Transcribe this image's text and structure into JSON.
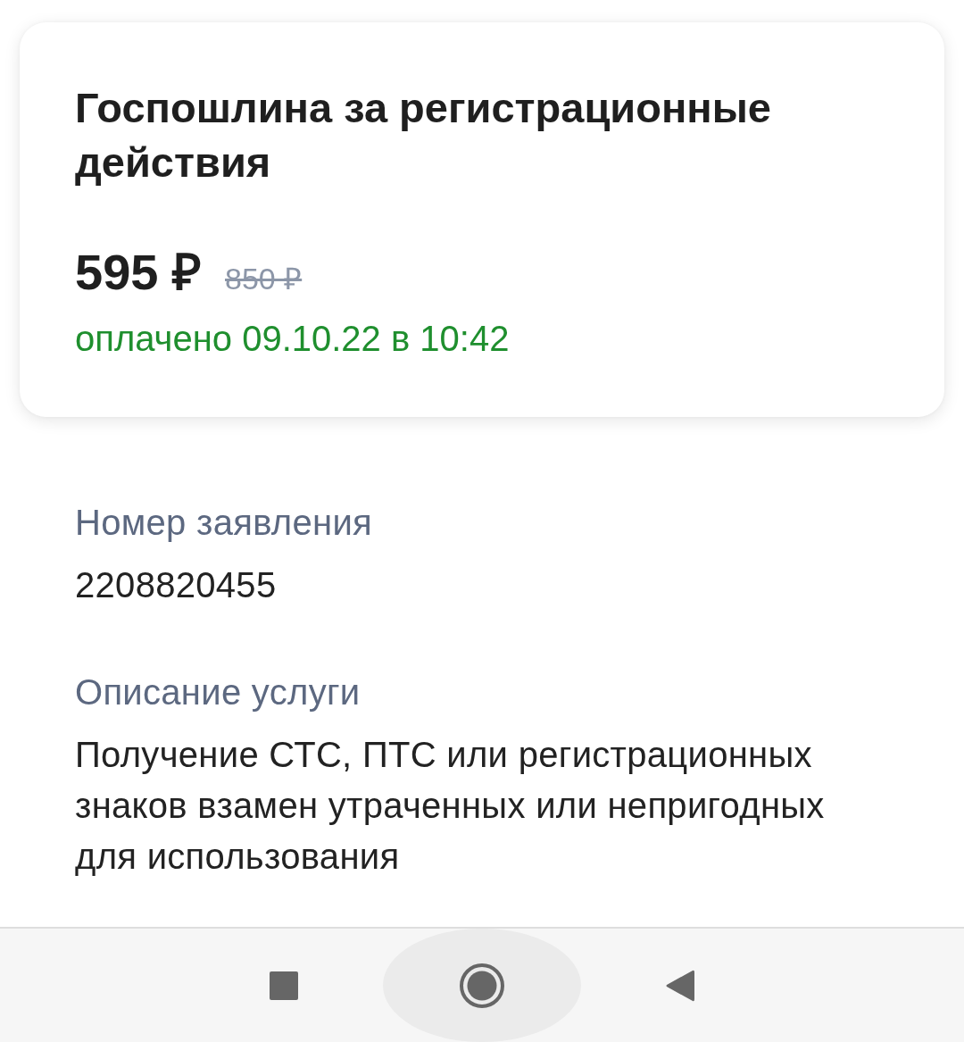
{
  "card": {
    "title": "Госпошлина за регистрационные действия",
    "price": "595 ₽",
    "old_price": "850 ₽",
    "payment_status": {
      "kind": "paid",
      "text": "оплачено 09.10.22 в 10:42"
    }
  },
  "details": [
    {
      "label": "Номер заявления",
      "value": "2208820455"
    },
    {
      "label": "Описание услуги",
      "value": "Получение СТС, ПТС или регистрационных знаков взамен утраченных или непригодных для использования"
    }
  ],
  "nav_bar": [
    {
      "kind": "recents"
    },
    {
      "kind": "home"
    },
    {
      "kind": "back"
    }
  ]
}
